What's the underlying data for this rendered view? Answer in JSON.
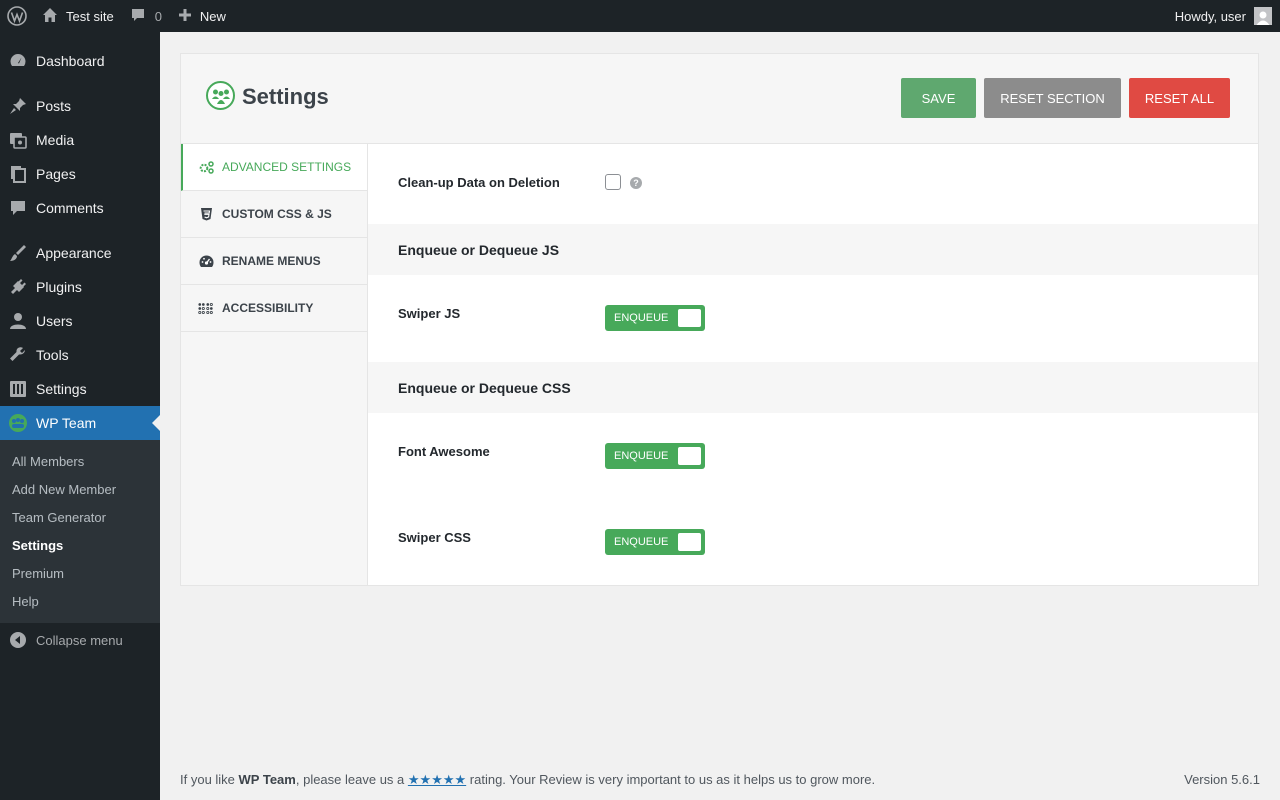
{
  "admin_bar": {
    "site_name": "Test site",
    "comments_count": "0",
    "new_label": "New",
    "greeting": "Howdy, user"
  },
  "sidebar": {
    "items": [
      {
        "label": "Dashboard",
        "icon": "dashboard-icon"
      },
      {
        "label": "Posts",
        "icon": "pin-icon"
      },
      {
        "label": "Media",
        "icon": "media-icon"
      },
      {
        "label": "Pages",
        "icon": "pages-icon"
      },
      {
        "label": "Comments",
        "icon": "comment-icon"
      },
      {
        "label": "Appearance",
        "icon": "brush-icon"
      },
      {
        "label": "Plugins",
        "icon": "plug-icon"
      },
      {
        "label": "Users",
        "icon": "user-icon"
      },
      {
        "label": "Tools",
        "icon": "wrench-icon"
      },
      {
        "label": "Settings",
        "icon": "sliders-icon"
      },
      {
        "label": "WP Team",
        "icon": "team-icon"
      }
    ],
    "submenu": [
      "All Members",
      "Add New Member",
      "Team Generator",
      "Settings",
      "Premium",
      "Help"
    ],
    "collapse_label": "Collapse menu"
  },
  "panel": {
    "title": "Settings",
    "buttons": {
      "save": "Save",
      "reset_section": "Reset Section",
      "reset_all": "Reset All"
    },
    "tabs": [
      {
        "label": "Advanced Settings",
        "icon": "gears-icon"
      },
      {
        "label": "Custom CSS & JS",
        "icon": "css3-icon"
      },
      {
        "label": "Rename Menus",
        "icon": "gauge-icon"
      },
      {
        "label": "Accessibility",
        "icon": "braille-icon"
      }
    ],
    "fields": {
      "cleanup_label": "Clean-up Data on Deletion",
      "cleanup_checked": false,
      "help_glyph": "?",
      "js_section": "Enqueue or Dequeue JS",
      "swiper_js_label": "Swiper JS",
      "css_section": "Enqueue or Dequeue CSS",
      "font_awesome_label": "Font Awesome",
      "swiper_css_label": "Swiper CSS",
      "toggle_label": "Enqueue"
    }
  },
  "footer": {
    "prefix": "If you like ",
    "brand": "WP Team",
    "middle": ", please leave us a ",
    "stars": "★★★★★",
    "suffix": " rating. Your Review is very important to us as it helps us to grow more.",
    "version": "Version 5.6.1"
  },
  "colors": {
    "accent_green": "#47a95a",
    "save_green": "#5fa86f",
    "reset_gray": "#8c8c8c",
    "reset_red": "#e04a43",
    "wp_blue": "#2271b1"
  }
}
